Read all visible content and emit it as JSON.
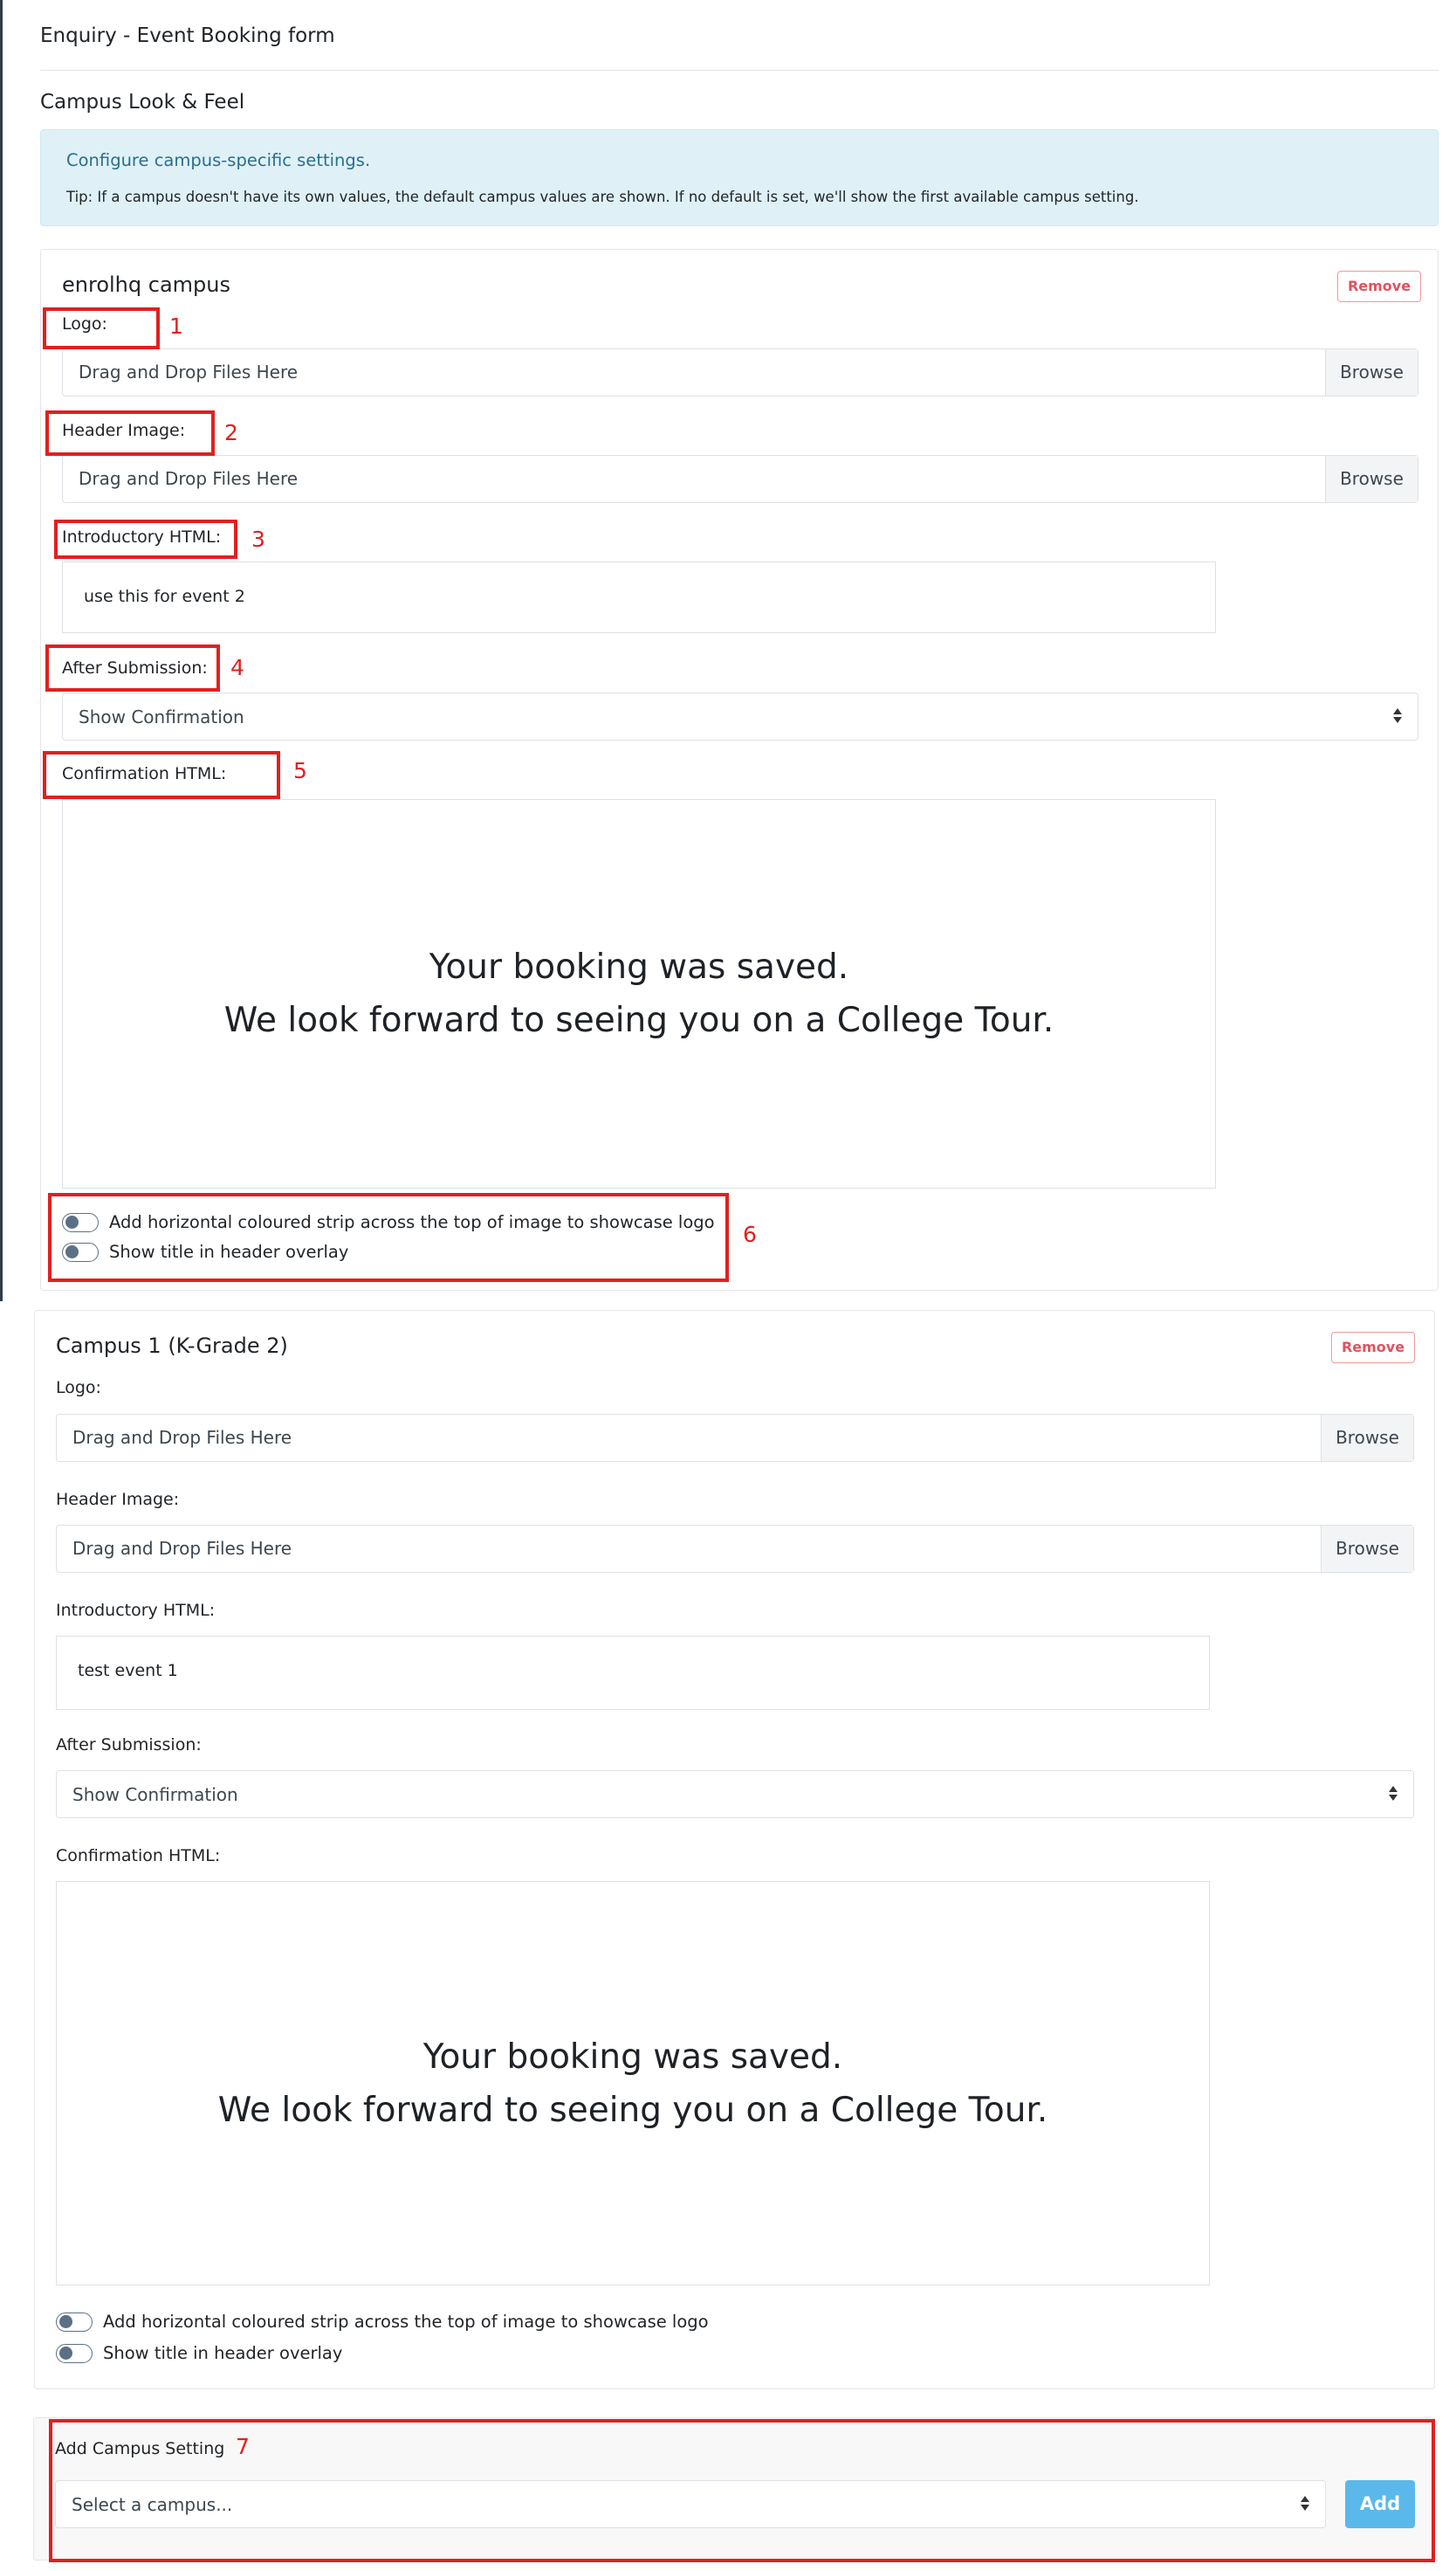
{
  "page": {
    "title": "Enquiry - Event Booking form",
    "section_title": "Campus Look & Feel"
  },
  "info": {
    "text": "Configure campus-specific settings.",
    "tip": "Tip: If a campus doesn't have its own values, the default campus values are shown. If no default is set, we'll show the first available campus setting."
  },
  "campuses": [
    {
      "name": "enrolhq campus",
      "remove_label": "Remove",
      "logo_label": "Logo:",
      "logo_placeholder": "Drag and Drop Files Here",
      "header_label": "Header Image:",
      "header_placeholder": "Drag and Drop Files Here",
      "browse_label": "Browse",
      "intro_label": "Introductory HTML:",
      "intro_value": "use this for event 2",
      "after_label": "After Submission:",
      "after_value": "Show Confirmation",
      "confirm_label": "Confirmation HTML:",
      "confirm_line1": "Your booking was saved.",
      "confirm_line2": "We look forward to seeing you on a College Tour.",
      "toggle1": "Add horizontal coloured strip across the top of image to showcase logo",
      "toggle2": "Show title in header overlay"
    },
    {
      "name": "Campus 1 (K-Grade 2)",
      "remove_label": "Remove",
      "logo_label": "Logo:",
      "logo_placeholder": "Drag and Drop Files Here",
      "header_label": "Header Image:",
      "header_placeholder": "Drag and Drop Files Here",
      "browse_label": "Browse",
      "intro_label": "Introductory HTML:",
      "intro_value": "test event 1",
      "after_label": "After Submission:",
      "after_value": "Show Confirmation",
      "confirm_label": "Confirmation HTML:",
      "confirm_line1": "Your booking was saved.",
      "confirm_line2": "We look forward to seeing you on a College Tour.",
      "toggle1": "Add horizontal coloured strip across the top of image to showcase logo",
      "toggle2": "Show title in header overlay"
    }
  ],
  "add_setting": {
    "label": "Add Campus Setting",
    "placeholder": "Select a campus...",
    "button": "Add"
  },
  "annotations": [
    "1",
    "2",
    "3",
    "4",
    "5",
    "6",
    "7"
  ],
  "colors": {
    "annotation": "#e02020",
    "info_bg": "#dff1f7",
    "remove": "#e05260",
    "add_button": "#5ab9ea",
    "toggle": "#5b7086"
  }
}
